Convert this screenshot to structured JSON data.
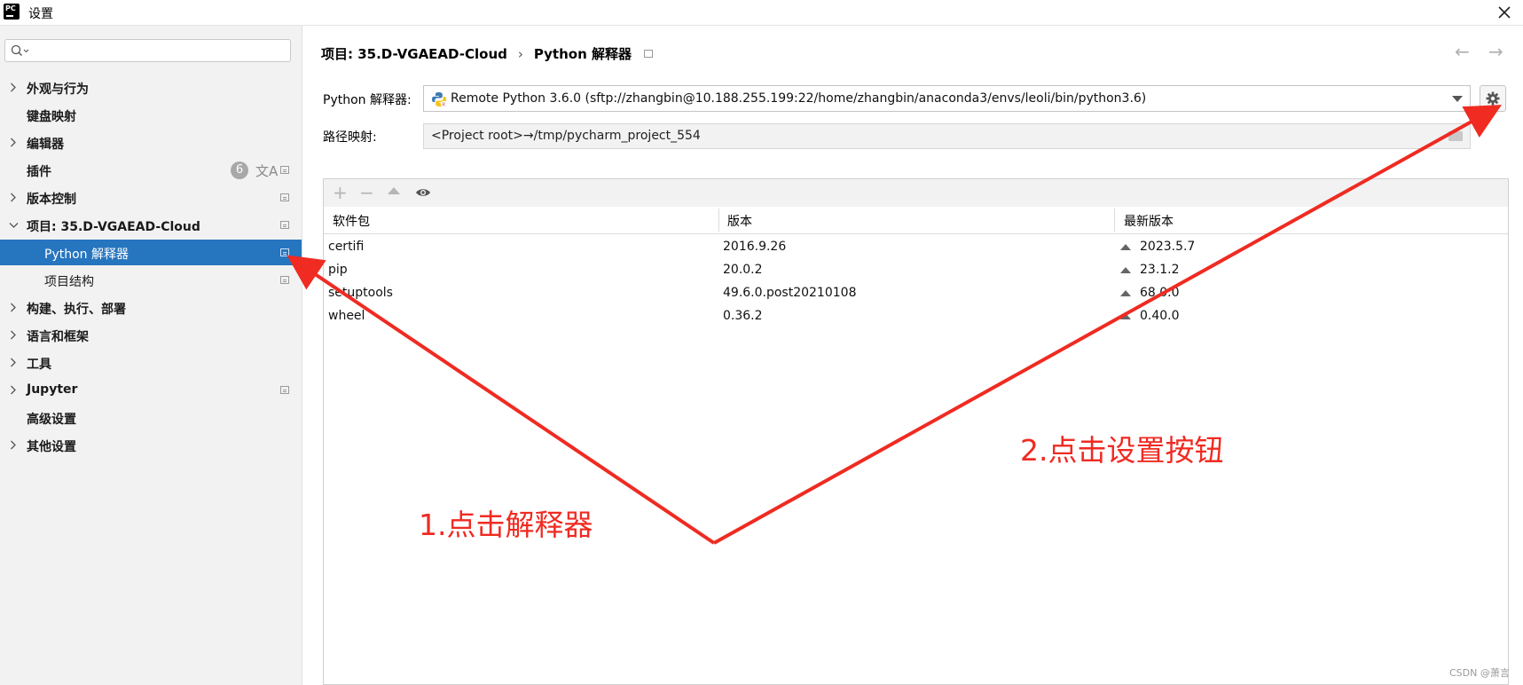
{
  "window": {
    "title": "设置"
  },
  "search": {
    "placeholder": ""
  },
  "sidebar": {
    "items": [
      {
        "label": "外观与行为"
      },
      {
        "label": "键盘映射"
      },
      {
        "label": "编辑器"
      },
      {
        "label": "插件",
        "badge": "6",
        "translate_icon": "文A"
      },
      {
        "label": "版本控制"
      },
      {
        "label": "项目: 35.D-VGAEAD-Cloud"
      },
      {
        "label": "Python 解释器"
      },
      {
        "label": "项目结构"
      },
      {
        "label": "构建、执行、部署"
      },
      {
        "label": "语言和框架"
      },
      {
        "label": "工具"
      },
      {
        "label": "Jupyter"
      },
      {
        "label": "高级设置"
      },
      {
        "label": "其他设置"
      }
    ],
    "selected": "Python 解释器"
  },
  "breadcrumb": {
    "project": "项目: 35.D-VGAEAD-Cloud",
    "separator": "›",
    "page": "Python 解释器"
  },
  "nav": {
    "back": "←",
    "forward": "→"
  },
  "interpreter": {
    "label": "Python 解释器:",
    "value": "Remote Python 3.6.0 (sftp://zhangbin@10.188.255.199:22/home/zhangbin/anaconda3/envs/leoli/bin/python3.6)"
  },
  "path_mapping": {
    "label": "路径映射:",
    "value": "<Project root>→/tmp/pycharm_project_554"
  },
  "toolbar": {
    "add": "+",
    "remove": "−"
  },
  "packages": {
    "columns": [
      "软件包",
      "版本",
      "最新版本"
    ],
    "rows": [
      {
        "name": "certifi",
        "version": "2016.9.26",
        "latest": "2023.5.7"
      },
      {
        "name": "pip",
        "version": "20.0.2",
        "latest": "23.1.2"
      },
      {
        "name": "setuptools",
        "version": "49.6.0.post20210108",
        "latest": "68.0.0"
      },
      {
        "name": "wheel",
        "version": "0.36.2",
        "latest": "0.40.0"
      }
    ]
  },
  "annotations": {
    "step1": "1.点击解释器",
    "step2": "2.点击设置按钮",
    "color": "#ef2b22"
  },
  "watermark": "CSDN @萧言",
  "colors": {
    "selection": "#2675bf",
    "sidebar_bg": "#f2f2f2"
  }
}
